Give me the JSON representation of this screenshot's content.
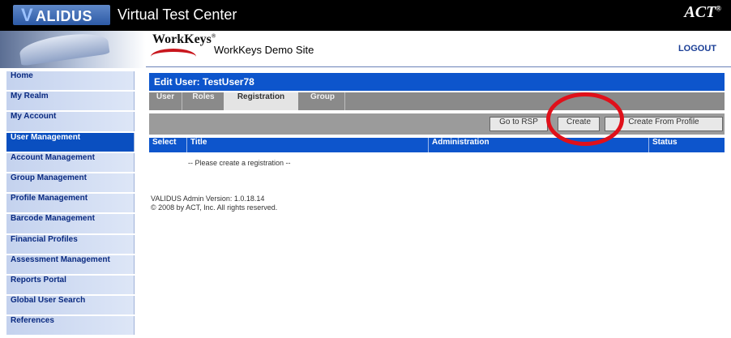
{
  "banner": {
    "logo_text": "ALIDUS",
    "logo_v": "V",
    "tagline": "Virtual Test Center",
    "act": "ACT"
  },
  "header": {
    "workkeys": "WorkKeys",
    "site_title": "WorkKeys Demo Site",
    "logout": "LOGOUT"
  },
  "sidebar": {
    "items": [
      {
        "label": "Home"
      },
      {
        "label": "My Realm"
      },
      {
        "label": "My Account"
      },
      {
        "label": "User Management"
      },
      {
        "label": "Account Management"
      },
      {
        "label": "Group Management"
      },
      {
        "label": "Profile Management"
      },
      {
        "label": "Barcode Management"
      },
      {
        "label": "Financial Profiles"
      },
      {
        "label": "Assessment Management"
      },
      {
        "label": "Reports Portal"
      },
      {
        "label": "Global User Search"
      },
      {
        "label": "References"
      }
    ],
    "active_index": 3
  },
  "main": {
    "title": "Edit User: TestUser78",
    "tabs": [
      {
        "label": "User"
      },
      {
        "label": "Roles"
      },
      {
        "label": "Registration"
      },
      {
        "label": "Group"
      }
    ],
    "selected_tab": "Registration",
    "buttons": {
      "go_to_rsp": "Go to RSP",
      "create": "Create",
      "create_from_profile": "Create From Profile"
    },
    "columns": [
      "Select",
      "Title",
      "Administration",
      "Status"
    ],
    "empty_message": "-- Please create a registration --",
    "version_line": "VALIDUS Admin Version: 1.0.18.14",
    "copyright_line": "© 2008 by ACT, Inc. All rights reserved."
  },
  "colors": {
    "primary_blue": "#0d55cc",
    "highlight_red": "#e0101a",
    "tab_gray": "#8a8a8a"
  }
}
